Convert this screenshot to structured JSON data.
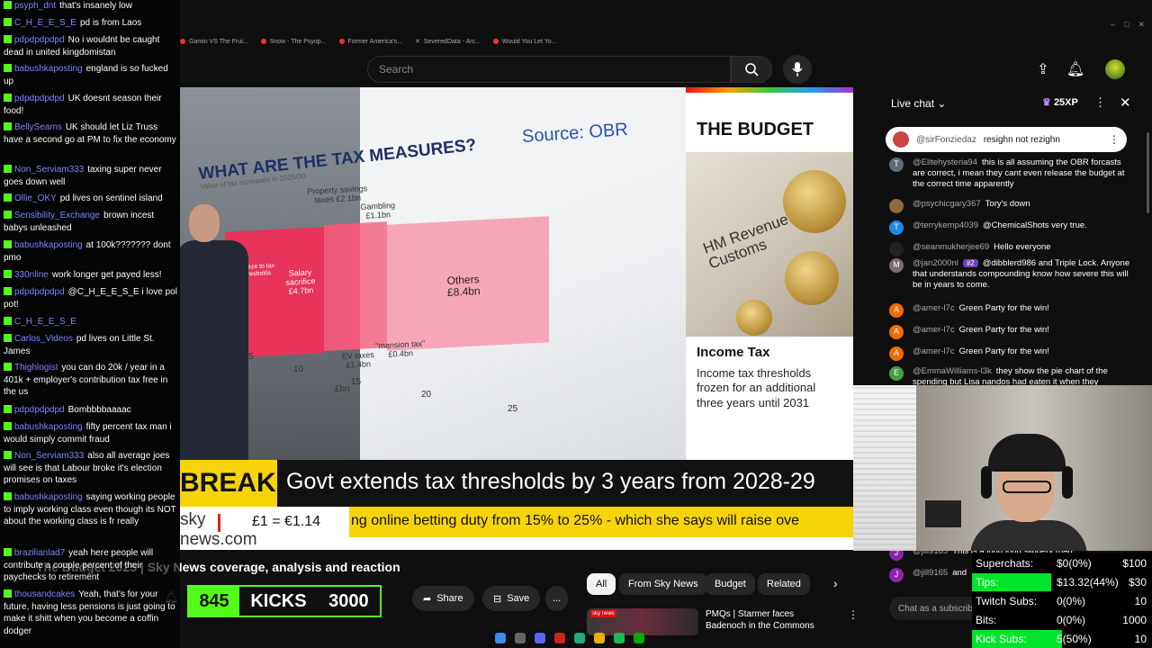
{
  "browser": {
    "tabs": [
      "Gamin VS The Frui...",
      "Snow - The Psyop...",
      "Former America's...",
      "SeveredData - Arc...",
      "Would You Let Yo..."
    ]
  },
  "header": {
    "search_placeholder": "Search"
  },
  "video": {
    "source": "Source: OBR",
    "question": "WHAT ARE THE TAX MEASURES?",
    "question_sub": "Value of tax increases in 2029/30",
    "chart_labels": {
      "property": "Property savings taxes £2.1bn",
      "gambling": "Gambling £1.1bn",
      "salary": "Salary sacrifice £4.7bn",
      "others": "Others £8.4bn",
      "mansion": "\"mansion tax\" £0.4bn",
      "ev": "EV taxes £1.4bn",
      "freeze": "Freeze to tax thresholds"
    },
    "ticks": [
      "5",
      "10",
      "15",
      "20",
      "25",
      "£bn"
    ],
    "panel_title": "THE BUDGET",
    "panel_img_text": "HM Revenue & Customs",
    "panel_sub": "Income Tax",
    "panel_body": "Income tax thresholds frozen for an additional three years until 2031",
    "breaking": "BREAKING NEWS",
    "headline": "Govt extends tax thresholds by 3 years from 2028-29",
    "ticker_logo": "sky news.com",
    "ticker_fx": "£1 = €1.14",
    "ticker_scroll": "ng online betting duty from 15% to 25% - which she says will raise ove"
  },
  "below": {
    "title": "The Budget 2025 | Sky News coverage, analysis and reaction",
    "kicks_count": "845",
    "kicks_label": "KICKS",
    "kicks_goal": "3000",
    "share": "Share",
    "save": "Save",
    "more": "..."
  },
  "chips": [
    "All",
    "From Sky News",
    "Budget",
    "Related"
  ],
  "recommended": {
    "title": "PMQs | Starmer faces Badenoch in the Commons",
    "badge": "sky news"
  },
  "livechat": {
    "title": "Live chat",
    "xp": "25XP",
    "pinned": {
      "author": "@sirFonziedaz",
      "text": "resighn not rezighn"
    },
    "messages": [
      {
        "initial": "T",
        "color": "#5b6b78",
        "author": "@Elitehysteria94",
        "badge": "",
        "text": "this is all assuming the OBR forcasts are correct, i mean they cant even release the budget at the correct time apparently"
      },
      {
        "initial": "",
        "color": "#8a6a3e",
        "author": "@psychicgary367",
        "badge": "",
        "text": "Tory's down"
      },
      {
        "initial": "T",
        "color": "#1e88e5",
        "author": "@terrykemp4039",
        "badge": "",
        "text": "@ChemicalShots very true."
      },
      {
        "initial": "",
        "color": "#222222",
        "author": "@seanmukherjee69",
        "badge": "",
        "text": "Hello everyone"
      },
      {
        "initial": "M",
        "color": "#7a6d6d",
        "author": "@jan2000nl",
        "badge": "#2",
        "text": "@dibblerd986 and Triple Lock. Anyone that understands compounding know how severe this will be in years to come."
      },
      {
        "initial": "A",
        "color": "#ef6c00",
        "author": "@amer-l7c",
        "badge": "",
        "text": "Green Party for the win!"
      },
      {
        "initial": "A",
        "color": "#ef6c00",
        "author": "@amer-l7c",
        "badge": "",
        "text": "Green Party for the win!"
      },
      {
        "initial": "A",
        "color": "#ef6c00",
        "author": "@amer-l7c",
        "badge": "",
        "text": "Green Party for the win!"
      },
      {
        "initial": "E",
        "color": "#43a047",
        "author": "@EmmaWilliams-l3k",
        "badge": "",
        "text": "they show the pie chart of the spending but Lisa nandos had eaten it when they"
      },
      {
        "initial": "J",
        "color": "#8e24aa",
        "author": "@jill9165",
        "badge": "",
        "text": "This is a long long slippery road"
      },
      {
        "initial": "J",
        "color": "#8e24aa",
        "author": "@jill9165",
        "badge": "",
        "text": "and"
      }
    ],
    "input_placeholder": "Chat as a subscriber..."
  },
  "overlay_chat": [
    {
      "user": "psyph_dnt",
      "text": "that's insanely low"
    },
    {
      "user": "C_H_E_E_S_E",
      "text": "pd is from Laos"
    },
    {
      "user": "pdpdpdpdpd",
      "text": "No i wouldnt be caught dead in united kingdomistan"
    },
    {
      "user": "babushkaposting",
      "text": "england is so fucked up"
    },
    {
      "user": "pdpdpdpdpd",
      "text": "UK doesnt season their food!"
    },
    {
      "user": "BellySeams",
      "text": "UK should let Liz Truss have a second go at PM to fix the economy"
    },
    {
      "user": "Non_Serviam333",
      "text": "taxing super never goes down well"
    },
    {
      "user": "Ollie_OKY",
      "text": "pd lives on sentinel island"
    },
    {
      "user": "Sensibility_Exchange",
      "text": "brown incest babys unleashed"
    },
    {
      "user": "babushkaposting",
      "text": "at 100k??????? dont pmo"
    },
    {
      "user": "330nline",
      "text": "work longer get payed less!"
    },
    {
      "user": "pdpdpdpdpd",
      "text": "@C_H_E_E_S_E i love pol pot!"
    },
    {
      "user": "C_H_E_E_S_E",
      "text": ""
    },
    {
      "user": "Carlos_Videos",
      "text": "pd lives on Little St. James"
    },
    {
      "user": "Thighlogist",
      "text": "you can do 20k / year in a 401k + employer's contribution tax free in the us"
    },
    {
      "user": "pdpdpdpdpd",
      "text": "Bombbbbaaaac"
    },
    {
      "user": "babushkaposting",
      "text": "fifty percent tax man i would simply commit fraud"
    },
    {
      "user": "Non_Serviam333",
      "text": "also all average joes will see is that Labour broke it's election promises on taxes"
    },
    {
      "user": "babushkaposting",
      "text": "saying working people to imply working class even though its NOT about the working class is fr really"
    },
    {
      "user": "brazilianlad7",
      "text": "yeah here people will contribute a couple percent of their paychecks to retirement"
    },
    {
      "user": "thousandcakes",
      "text": "Yeah, that's for your future, having less pensions is just going to make it shitt when you become a coffin dodger"
    }
  ],
  "goals": [
    {
      "name": "Superchats:",
      "val": "$0(0%)",
      "tgt": "$100",
      "pct": 0
    },
    {
      "name": "Tips:",
      "val": "$13.32(44%)",
      "tgt": "$30",
      "pct": 44
    },
    {
      "name": "Twitch Subs:",
      "val": "0(0%)",
      "tgt": "10",
      "pct": 0
    },
    {
      "name": "Bits:",
      "val": "0(0%)",
      "tgt": "1000",
      "pct": 0
    },
    {
      "name": "Kick Subs:",
      "val": "5(50%)",
      "tgt": "10",
      "pct": 50
    }
  ],
  "colors": {
    "kick_green": "#53fc18",
    "goal_green": "#00e52b",
    "breaking_yellow": "#f6d409"
  }
}
